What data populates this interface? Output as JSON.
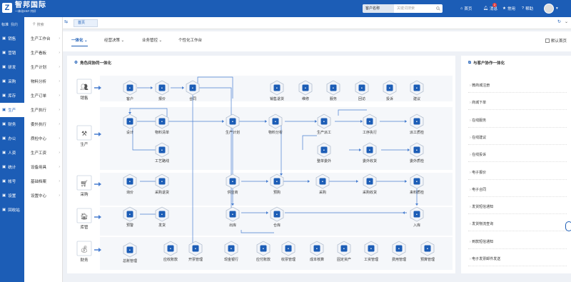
{
  "brand": {
    "name": "智邦国际",
    "tagline": "一体化ERP·共好"
  },
  "top": {
    "search_select": "客户名称",
    "search_placeholder": "关键词搜索",
    "menu": [
      {
        "label": "首页",
        "icon": "home-icon"
      },
      {
        "label": "消息",
        "icon": "bell-icon",
        "badge": "2"
      },
      {
        "label": "常用",
        "icon": "star-icon"
      },
      {
        "label": "帮助",
        "icon": "help-icon"
      }
    ]
  },
  "sidebar": {
    "head": [
      "标准",
      "我的"
    ],
    "items": [
      {
        "label": "销售",
        "icon": "sales-icon"
      },
      {
        "label": "营销",
        "icon": "marketing-icon"
      },
      {
        "label": "研发",
        "icon": "rd-icon"
      },
      {
        "label": "采购",
        "icon": "purchase-icon"
      },
      {
        "label": "库存",
        "icon": "stock-icon"
      },
      {
        "label": "生产",
        "icon": "production-icon",
        "active": true
      },
      {
        "label": "财务",
        "icon": "finance-icon"
      },
      {
        "label": "办公",
        "icon": "office-icon"
      },
      {
        "label": "人资",
        "icon": "hr-icon"
      },
      {
        "label": "统计",
        "icon": "stats-icon"
      },
      {
        "label": "帐号",
        "icon": "account-icon"
      },
      {
        "label": "设置",
        "icon": "settings-icon"
      },
      {
        "label": "回收站",
        "icon": "recycle-icon"
      }
    ]
  },
  "submenu": {
    "search_placeholder": "搜索",
    "items": [
      "生产工作台",
      "生产看板",
      "生产计划",
      "物料分析",
      "生产订单",
      "生产执行",
      "委外执行",
      "质检中心",
      "生产工资",
      "设备用具",
      "基础档案",
      "设置中心"
    ]
  },
  "tabs": {
    "home": "首页"
  },
  "subtabs": [
    "一体化",
    "经营决策",
    "业务管控",
    "个性化工作台"
  ],
  "default_home": "默认首页",
  "flow": {
    "title": "角色间协同一体化",
    "roles": [
      "销售",
      "生产",
      "采购",
      "库管",
      "财务"
    ],
    "sales": [
      "客户",
      "报价",
      "合同",
      "销售退货",
      "维修",
      "服务",
      "回访",
      "投诉",
      "建议"
    ],
    "production": [
      "设计",
      "物料清单",
      "工艺路线",
      "生产计划",
      "物料分析",
      "生产派工",
      "工序执行",
      "派工质检",
      "整单委外",
      "委外收货",
      "委外质检"
    ],
    "purchase": [
      "询价",
      "采购退货",
      "供应商",
      "预购",
      "采购",
      "采购收货",
      "来料质检"
    ],
    "stock": [
      "预警",
      "发货",
      "出库",
      "仓库",
      "入库"
    ],
    "finance": [
      "总账管理",
      "应收账款",
      "开票管理",
      "现金银行",
      "应付账款",
      "收票管理",
      "成本核算",
      "固定资产",
      "工资管理",
      "费用管理",
      "预算管理"
    ]
  },
  "right": {
    "title": "与客户协作一体化",
    "items": [
      "微商城注册",
      "商城下单",
      "在线服务",
      "在线建议",
      "在线投诉",
      "电子报价",
      "电子合同",
      "发货短信通知",
      "发货物流查询",
      "到款短信通知",
      "电子发票邮件发送"
    ]
  },
  "colors": {
    "brand": "#1c5db6",
    "icon_bg": "#e9eef6",
    "icon_fg": "#1c5db6",
    "arrow": "#4a7fd0"
  }
}
